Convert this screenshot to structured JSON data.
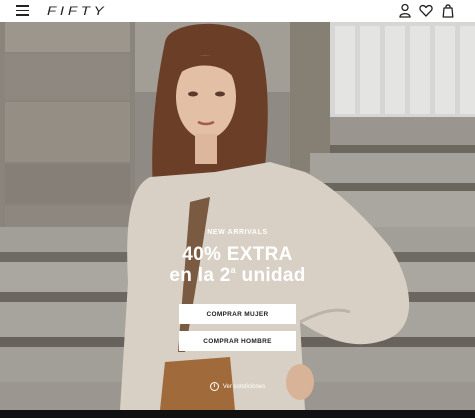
{
  "header": {
    "logo": "FIFTY",
    "menu_icon": "hamburger-menu-icon",
    "account_icon": "user-icon",
    "wishlist_icon": "heart-icon",
    "bag_icon": "shopping-bag-icon"
  },
  "hero": {
    "eyebrow": "NEW ARRIVALS",
    "headline_line1": "40% EXTRA",
    "headline_line2_pre": "en la 2",
    "headline_line2_sup": "a",
    "headline_line2_post": " unidad",
    "cta_women": "COMPRAR MUJER",
    "cta_men": "COMPRAR HOMBRE",
    "conditions_icon": "i",
    "conditions_label": "Ver condiciones"
  },
  "colors": {
    "header_bg": "#ffffff",
    "text_dark": "#222222",
    "hero_text": "#ffffff",
    "button_bg": "#ffffff",
    "bottom_bar": "#111111"
  }
}
